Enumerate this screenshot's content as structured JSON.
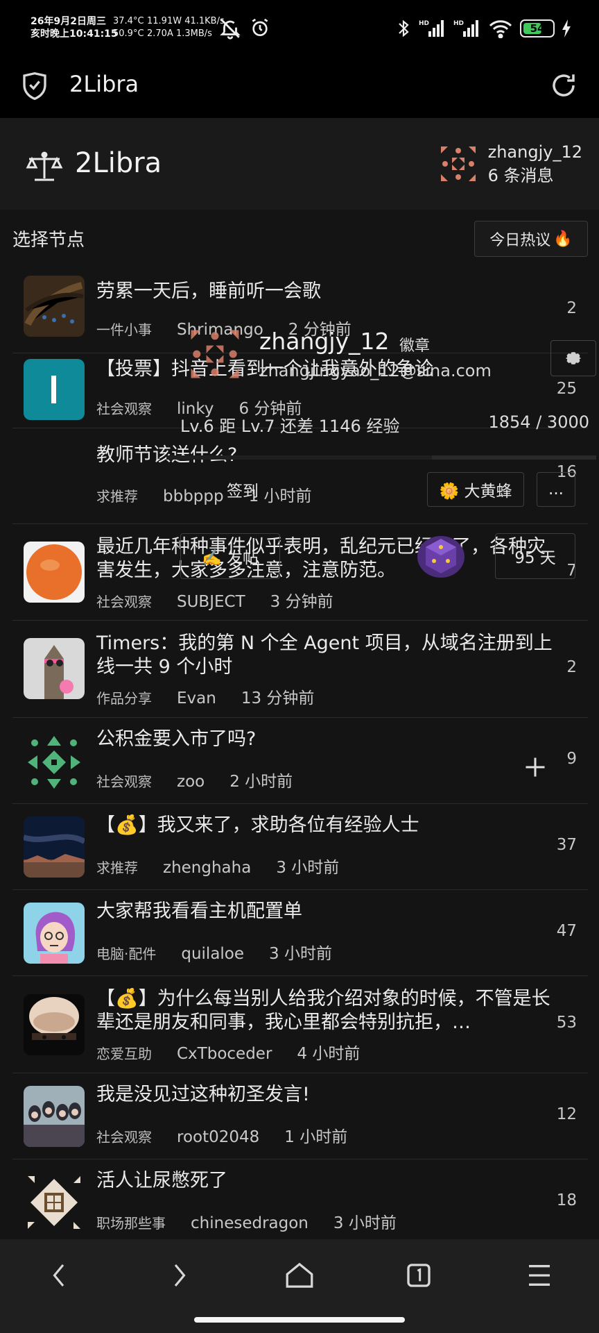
{
  "status_bar": {
    "date_line": "26年9月2日周三",
    "time_line": "亥时晚上10:41:15",
    "temp1": "37.4°C",
    "temp2": "50.9°C",
    "stat_line1": "11.91W 41.1KB/s",
    "stat_line2": "2.70A 1.3MB/s",
    "battery": "54"
  },
  "browser": {
    "title": "2Libra"
  },
  "header": {
    "logo_text": "2Libra",
    "username": "zhangjy_12",
    "messages": "6 条消息"
  },
  "sidebar": {
    "node_label": "选择节点"
  },
  "hot_tab": "今日热议",
  "popup": {
    "name": "zhangjy_12",
    "badge_label": "徽章",
    "email": "zhangjingyao_12@sina.com",
    "level": "Lv.6   距 Lv.7 还差 1146 经验",
    "exp": "1854 / 3000",
    "exp_fraction": 0.618,
    "signin_label": "签到",
    "tag_label": "🌼 大黄蜂",
    "more_label": "...",
    "post_label": "✍️ 发帖",
    "days_label": "95 天"
  },
  "topics": [
    {
      "title": "劳累一天后，睡前听一会歌",
      "node": "一件小事",
      "author": "Shrimango",
      "time": "2 分钟前",
      "count": "2",
      "avatar": "sheet"
    },
    {
      "title": "【投票】抖音上看到一个让我意外的争论",
      "node": "社会观察",
      "author": "linky",
      "time": "6 分钟前",
      "count": "25",
      "avatar": "letter"
    },
    {
      "title": "教师节该送什么?",
      "node": "求推荐",
      "author": "bbbppp",
      "time": "1 小时前",
      "count": "16",
      "avatar": "none"
    },
    {
      "title": "最近几年种种事件似乎表明，乱纪元已经来了，各种灾害发生，大家多多注意，注意防范。",
      "node": "社会观察",
      "author": "SUBJECT",
      "time": "3 分钟前",
      "count": "7",
      "avatar": "orange"
    },
    {
      "title": "Timers：我的第 N 个全 Agent 项目，从域名注册到上线一共 9 个小时",
      "node": "作品分享",
      "author": "Evan",
      "time": "13 分钟前",
      "count": "2",
      "avatar": "giraffe"
    },
    {
      "title": "公积金要入市了吗?",
      "node": "社会观察",
      "author": "zoo",
      "time": "2 小时前",
      "count": "9",
      "avatar": "green"
    },
    {
      "title": "【💰】我又来了，求助各位有经验人士",
      "node": "求推荐",
      "author": "zhenghaha",
      "time": "3 小时前",
      "count": "37",
      "avatar": "night"
    },
    {
      "title": "大家帮我看看主机配置单",
      "node": "电脑·配件",
      "author": "quilaloe",
      "time": "3 小时前",
      "count": "47",
      "avatar": "girl"
    },
    {
      "title": "【💰】为什么每当别人给我介绍对象的时候，不管是长辈还是朋友和同事，我心里都会特别抗拒，…",
      "node": "恋爱互助",
      "author": "CxTboceder",
      "time": "4 小时前",
      "count": "53",
      "avatar": "face"
    },
    {
      "title": "我是没见过这种初圣发言!",
      "node": "社会观察",
      "author": "root02048",
      "time": "1 小时前",
      "count": "12",
      "avatar": "group"
    },
    {
      "title": "活人让尿憋死了",
      "node": "职场那些事",
      "author": "chinesedragon",
      "time": "3 小时前",
      "count": "18",
      "avatar": "pattern"
    }
  ],
  "colors": {
    "page_bg": "#141414",
    "header_bg": "#1a1a1a",
    "nav_bg": "#1f1f1f",
    "battery_green": "#3ec95a"
  }
}
